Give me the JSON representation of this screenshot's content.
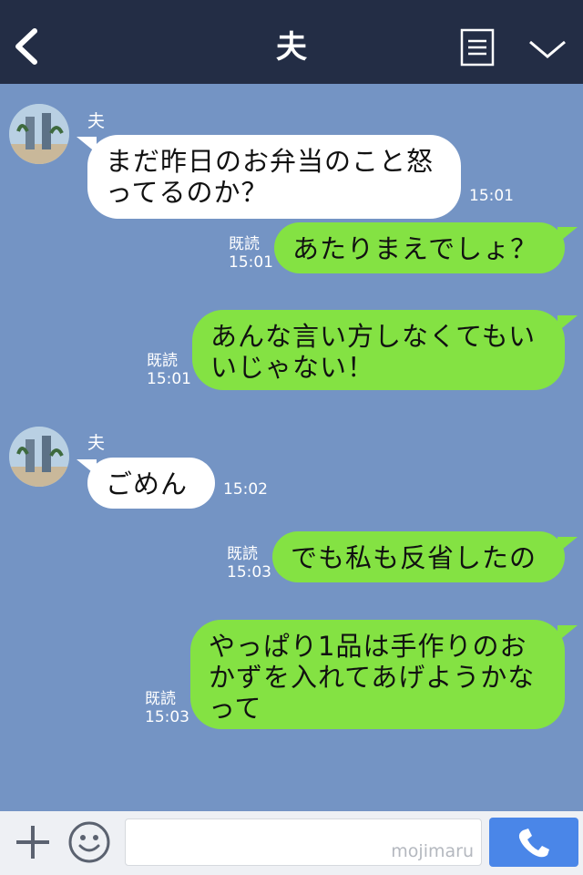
{
  "header": {
    "title": "夫",
    "back_icon": "chevron-left-icon",
    "menu_icon": "memo-list-icon",
    "collapse_icon": "chevron-down-icon"
  },
  "messages": [
    {
      "side": "in",
      "sender": "夫",
      "lines": [
        "まだ昨日のお弁当のこと怒",
        "ってるのか？"
      ],
      "time": "15:01"
    },
    {
      "side": "out",
      "lines": [
        "あたりまえでしょ？"
      ],
      "read": "既読",
      "time": "15:01"
    },
    {
      "side": "out",
      "lines": [
        "あんな言い方しなくてもい",
        "いじゃない！"
      ],
      "read": "既読",
      "time": "15:01"
    },
    {
      "side": "in",
      "sender": "夫",
      "lines": [
        "ごめん"
      ],
      "time": "15:02"
    },
    {
      "side": "out",
      "lines": [
        "でも私も反省したの"
      ],
      "read": "既読",
      "time": "15:03"
    },
    {
      "side": "out",
      "lines": [
        "やっぱり1品は手作りのお",
        "かずを入れてあげようかな",
        "って"
      ],
      "read": "既読",
      "time": "15:03"
    }
  ],
  "footer": {
    "input_value": "",
    "watermark": "mojimaru",
    "plus_icon": "plus-icon",
    "emoji_icon": "smiley-icon",
    "call_icon": "phone-icon"
  },
  "colors": {
    "header_bg": "#232d45",
    "chat_bg": "#7494c4",
    "outgoing_bubble": "#84e243",
    "incoming_bubble": "#ffffff",
    "call_button": "#4a86e8"
  }
}
